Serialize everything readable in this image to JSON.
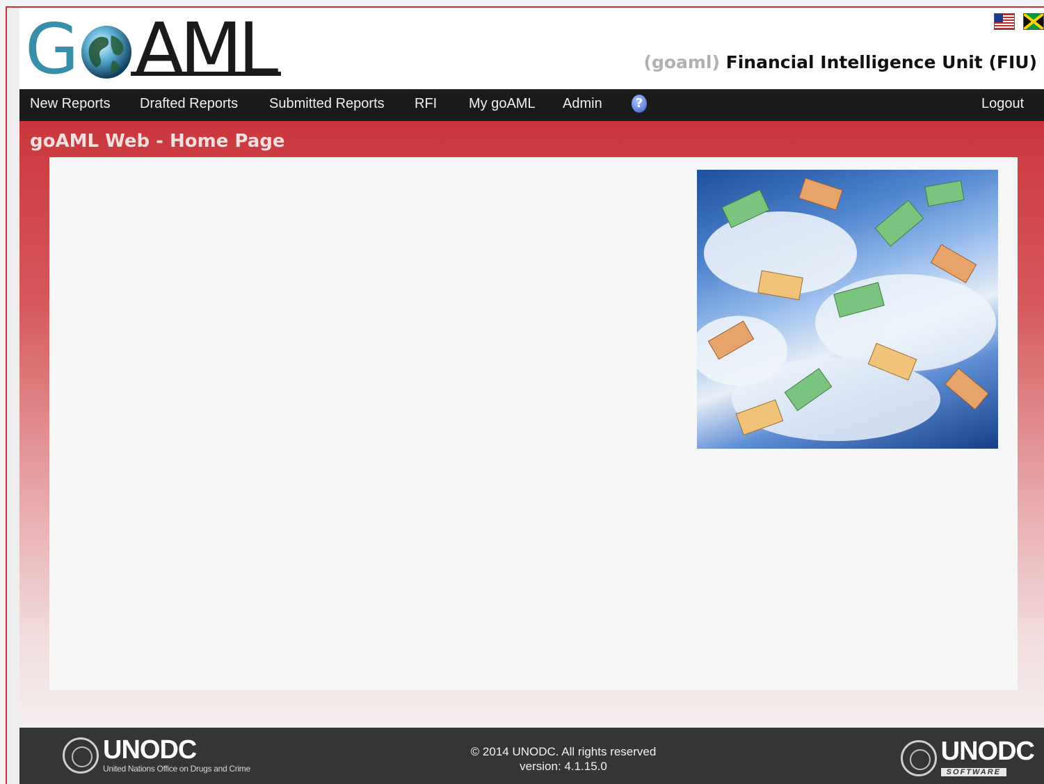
{
  "header": {
    "logo_letters": [
      "G",
      "AML"
    ],
    "org_code": "(goaml)",
    "org_name": "Financial Intelligence Unit (FIU)",
    "language_flags": [
      "us-flag-icon",
      "jamaica-flag-icon"
    ]
  },
  "nav": {
    "items": [
      "New Reports",
      "Drafted Reports",
      "Submitted Reports",
      "RFI",
      "My goAML",
      "Admin"
    ],
    "help_icon": "question-mark",
    "logout": "Logout"
  },
  "main": {
    "page_title": "goAML Web - Home Page",
    "hero_image": "euro-banknotes-in-sky"
  },
  "footer": {
    "left_logo_word": "UNODC",
    "left_logo_sub": "United Nations Office on Drugs and Crime",
    "copyright": "© 2014 UNODC. All rights reserved",
    "version": "version: 4.1.15.0",
    "right_logo_word": "UNODC",
    "right_logo_tag": "SOFTWARE"
  },
  "colors": {
    "nav_bg": "#1a1a1a",
    "header_red": "#c9373b",
    "logo_teal": "#3a8fa8",
    "footer_bg": "#353535"
  }
}
